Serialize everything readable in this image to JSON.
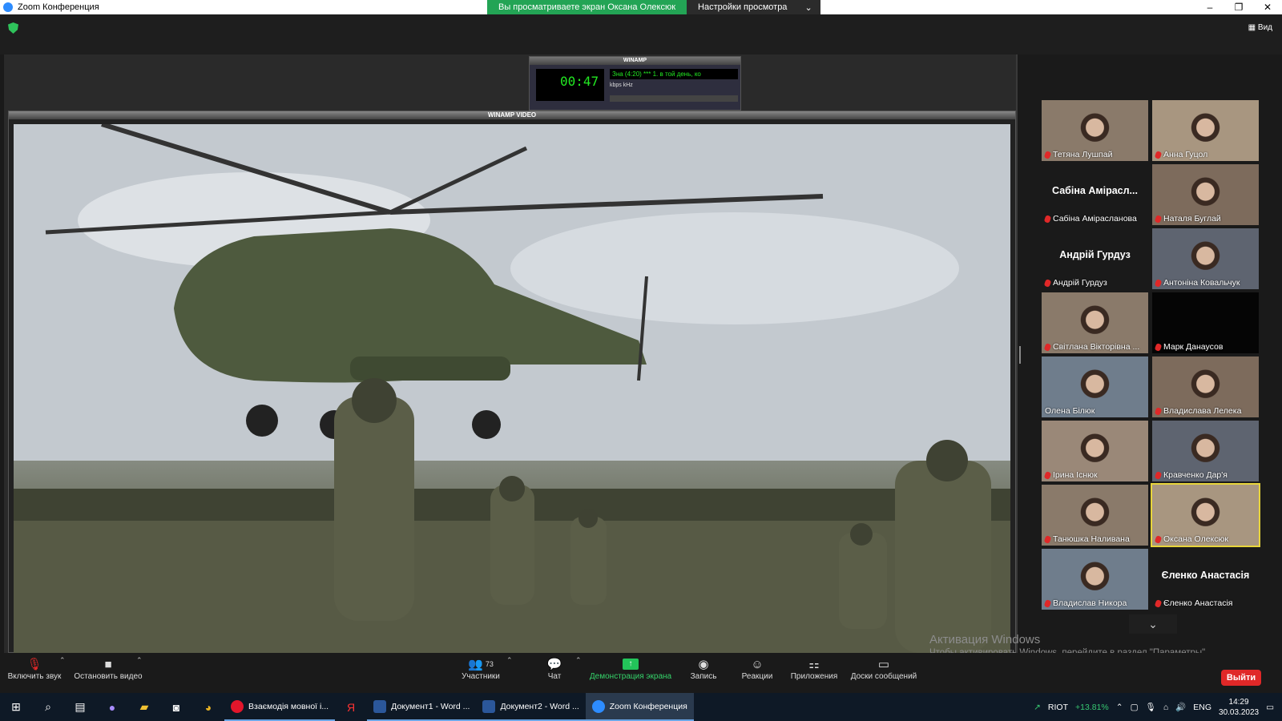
{
  "window": {
    "title": "Zoom Конференция",
    "share_notice": "Вы просматриваете экран Оксана Олексюк",
    "view_settings": "Настройки просмотра",
    "view_button": "Вид"
  },
  "winamp": {
    "title": "WINAMP",
    "time": "00:47",
    "song": "Зна (4:20) *** 1. в той день, ко",
    "kbps": "kbps",
    "khz": "kHz",
    "video_title": "WINAMP VIDEO"
  },
  "participants": [
    {
      "name": "Тетяна Лушпай",
      "video": true,
      "muted": true
    },
    {
      "name": "Анна Гуцол",
      "video": true,
      "muted": true
    },
    {
      "name": "Сабіна Амірасланова",
      "big": "Сабіна Амірасл...",
      "video": false,
      "muted": true
    },
    {
      "name": "Наталя Буглай",
      "video": true,
      "muted": true
    },
    {
      "name": "Андрій Гурдуз",
      "big": "Андрій Гурдуз",
      "video": false,
      "muted": true
    },
    {
      "name": "Антоніна Ковальчук",
      "video": true,
      "muted": true
    },
    {
      "name": "Світлана Вікторівна ...",
      "video": true,
      "muted": true
    },
    {
      "name": "Марк Данаусов",
      "video": true,
      "muted": true
    },
    {
      "name": "Олена Білюк",
      "video": true,
      "muted": false
    },
    {
      "name": "Владислава Лелека",
      "video": true,
      "muted": true
    },
    {
      "name": "Ірина Існюк",
      "video": true,
      "muted": true
    },
    {
      "name": "Кравченко Дар'я",
      "video": true,
      "muted": true
    },
    {
      "name": "Танюшка Наливана",
      "video": true,
      "muted": true
    },
    {
      "name": "Оксана Олексюк",
      "video": true,
      "muted": true,
      "active": true
    },
    {
      "name": "Владислав Никора",
      "video": true,
      "muted": true
    },
    {
      "name": "Єленко Анастасія",
      "big": "Єленко Анастасія",
      "video": false,
      "muted": true
    }
  ],
  "activation": {
    "title": "Активация Windows",
    "text": "Чтобы активировать Windows, перейдите в раздел \"Параметры\"."
  },
  "controls": {
    "unmute": "Включить звук",
    "stop_video": "Остановить видео",
    "participants": "Участники",
    "participants_count": "73",
    "chat": "Чат",
    "share_screen": "Демонстрация экрана",
    "record": "Запись",
    "reactions": "Реакции",
    "apps": "Приложения",
    "whiteboards": "Доски сообщений",
    "leave": "Выйти"
  },
  "taskbar": {
    "apps": [
      "Взаємодія мовної і...",
      "Документ1 - Word ...",
      "Документ2 - Word ...",
      "Zoom Конференция"
    ],
    "riot_label": "RIOT",
    "riot_change": "+13.81%",
    "lang": "ENG",
    "time": "14:29",
    "date": "30.03.2023"
  },
  "colors": {
    "share_green": "#23a455",
    "leave_red": "#e02828",
    "active_speaker": "#e8d53b"
  }
}
